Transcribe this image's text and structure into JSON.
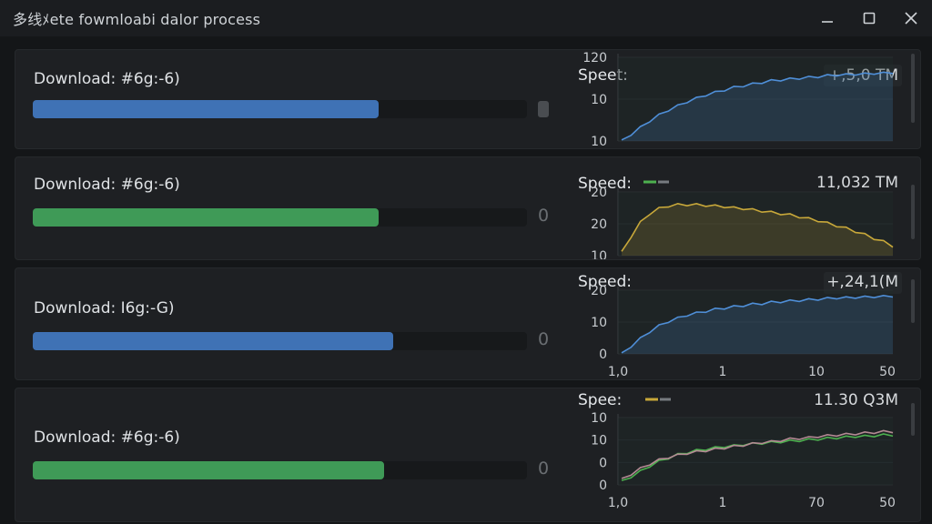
{
  "window": {
    "title": "多线ﾒete fowmloabi dalor process"
  },
  "panels": [
    {
      "download_label": "Download: #6g:-6)",
      "progress_pct": 70,
      "bar_color": "#3f72b5",
      "pct_text": "",
      "speed_label": "Speet:",
      "speed_value": "+,5,0 TM",
      "speed_value_color": "#4db04f",
      "chart_data": {
        "type": "area",
        "y_ticks": [
          "120",
          "10",
          "10"
        ],
        "x_ticks": [],
        "series": [
          {
            "color": "#4f8fd8",
            "values": [
              0,
              8,
              16,
              24,
              31,
              37,
              42,
              47,
              51,
              55,
              58,
              61,
              64,
              66,
              68,
              70,
              72,
              73,
              74,
              75,
              76,
              77,
              78,
              79,
              79,
              80,
              80,
              81,
              81,
              82
            ]
          }
        ]
      }
    },
    {
      "download_label": "Download: #6g:-6)",
      "progress_pct": 70,
      "bar_color": "#3f9a57",
      "pct_text": "0",
      "speed_label": "Speed:",
      "speed_value": "11,032 TM",
      "speed_value_color": "#d7dadd",
      "legend_colors": [
        "#4db04f",
        "#777b80"
      ],
      "chart_data": {
        "type": "area",
        "y_ticks": [
          "20",
          "20",
          "10"
        ],
        "x_ticks": [],
        "series": [
          {
            "color": "#c8a83a",
            "values": [
              5,
              30,
              52,
              66,
              74,
              78,
              80,
              80,
              80,
              79,
              78,
              77,
              75,
              74,
              72,
              70,
              68,
              66,
              64,
              61,
              58,
              55,
              51,
              47,
              43,
              38,
              33,
              27,
              22,
              15
            ]
          }
        ]
      }
    },
    {
      "download_label": "Download: I6g:-G)",
      "progress_pct": 73,
      "bar_color": "#3f72b5",
      "pct_text": "0",
      "speed_label": "Speed:",
      "speed_value": "+,24,1(M",
      "speed_value_color": "#d7dadd",
      "chart_data": {
        "type": "area",
        "y_ticks": [
          "20",
          "10",
          "0"
        ],
        "x_ticks": [
          "1,0",
          "1",
          "10",
          "50"
        ],
        "series": [
          {
            "color": "#4f8fd8",
            "values": [
              0,
              12,
              24,
              35,
              44,
              51,
              56,
              61,
              64,
              67,
              70,
              72,
              74,
              76,
              78,
              79,
              81,
              82,
              83,
              84,
              85,
              86,
              87,
              88,
              88,
              89,
              89,
              90,
              90,
              91
            ]
          }
        ]
      }
    },
    {
      "download_label": "Download: #6g:-6)",
      "progress_pct": 71,
      "bar_color": "#3f9a57",
      "pct_text": "0",
      "speed_label": "Spee:",
      "speed_value": "11.30 Q3M",
      "speed_value_color": "#d7dadd",
      "legend_colors": [
        "#c8a83a",
        "#777b80"
      ],
      "chart_data": {
        "type": "line",
        "y_ticks": [
          "10",
          "10",
          "0",
          "0"
        ],
        "x_ticks": [
          "1,0",
          "1",
          "70",
          "50"
        ],
        "series": [
          {
            "color": "#4db04f",
            "values": [
              5,
              12,
              20,
              28,
              35,
              40,
              45,
              48,
              51,
              53,
              55,
              57,
              58,
              60,
              61,
              62,
              63,
              64,
              65,
              66,
              67,
              68,
              69,
              70,
              71,
              72,
              72,
              73,
              74,
              74
            ]
          },
          {
            "color": "#b48a94",
            "values": [
              8,
              16,
              24,
              31,
              37,
              41,
              44,
              47,
              49,
              51,
              53,
              55,
              57,
              59,
              61,
              63,
              64,
              66,
              68,
              69,
              70,
              72,
              73,
              74,
              75,
              76,
              77,
              78,
              79,
              79
            ]
          }
        ]
      }
    }
  ]
}
